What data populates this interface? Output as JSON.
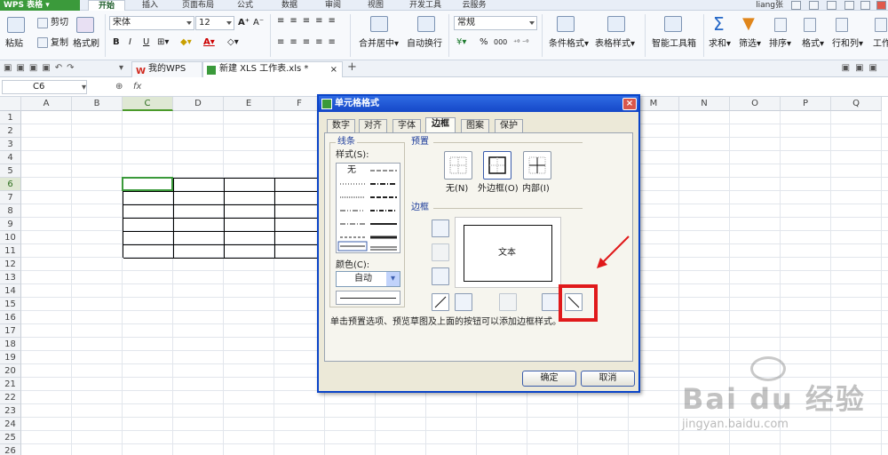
{
  "app_button": "WPS 表格",
  "menu": {
    "tabs": [
      "开始",
      "插入",
      "页面布局",
      "公式",
      "数据",
      "审阅",
      "视图",
      "开发工具",
      "云服务"
    ],
    "user": "liang张"
  },
  "ribbon": {
    "paste": "粘贴",
    "cut": "剪切",
    "copy": "复制",
    "format_painter": "格式刷",
    "font_name": "宋体",
    "font_size": "12",
    "bold": "B",
    "italic": "I",
    "underline": "U",
    "merge_center": "合并居中",
    "wrap_text": "自动换行",
    "number_format": "常规",
    "percent": "%",
    "comma": "000",
    "conditional_format": "条件格式",
    "table_style": "表格样式",
    "smart_toolbox": "智能工具箱",
    "sum": "求和",
    "filter": "筛选",
    "sort": "排序",
    "format": "格式",
    "row_col": "行和列",
    "worksheet": "工作"
  },
  "doc_tabs": [
    {
      "label": "我的WPS"
    },
    {
      "label": "新建 XLS 工作表.xls *"
    }
  ],
  "formula_bar": {
    "cell_ref": "C6",
    "fx": "fx",
    "content": ""
  },
  "columns": [
    "A",
    "B",
    "C",
    "D",
    "E",
    "F",
    "G",
    "H",
    "I",
    "J",
    "K",
    "L",
    "M",
    "N",
    "O",
    "P",
    "Q"
  ],
  "rows": [
    "1",
    "2",
    "3",
    "4",
    "5",
    "6",
    "7",
    "8",
    "9",
    "10",
    "11",
    "12",
    "13",
    "14",
    "15",
    "16",
    "17",
    "18",
    "19",
    "20",
    "21",
    "22",
    "23",
    "24",
    "25",
    "26"
  ],
  "active_cell": "C6",
  "dialog": {
    "title": "单元格格式",
    "tabs": [
      "数字",
      "对齐",
      "字体",
      "边框",
      "图案",
      "保护"
    ],
    "active_tab": "边框",
    "line_group": "线条",
    "style_label": "样式(S):",
    "style_none": "无",
    "color_label": "颜色(C):",
    "color_value": "自动",
    "presets_label": "预置",
    "preset_none": "无(N)",
    "preset_outline": "外边框(O)",
    "preset_inside": "内部(I)",
    "border_label": "边框",
    "preview_text": "文本",
    "hint": "单击预置选项、预览草图及上面的按钮可以添加边框样式。",
    "ok": "确定",
    "cancel": "取消"
  },
  "watermark": {
    "brand": "Bai du 经验",
    "url": "jingyan.baidu.com"
  },
  "colors": {
    "accent_green": "#3b9a3b",
    "highlight_red": "#e0191b",
    "title_blue": "#1548c8"
  }
}
